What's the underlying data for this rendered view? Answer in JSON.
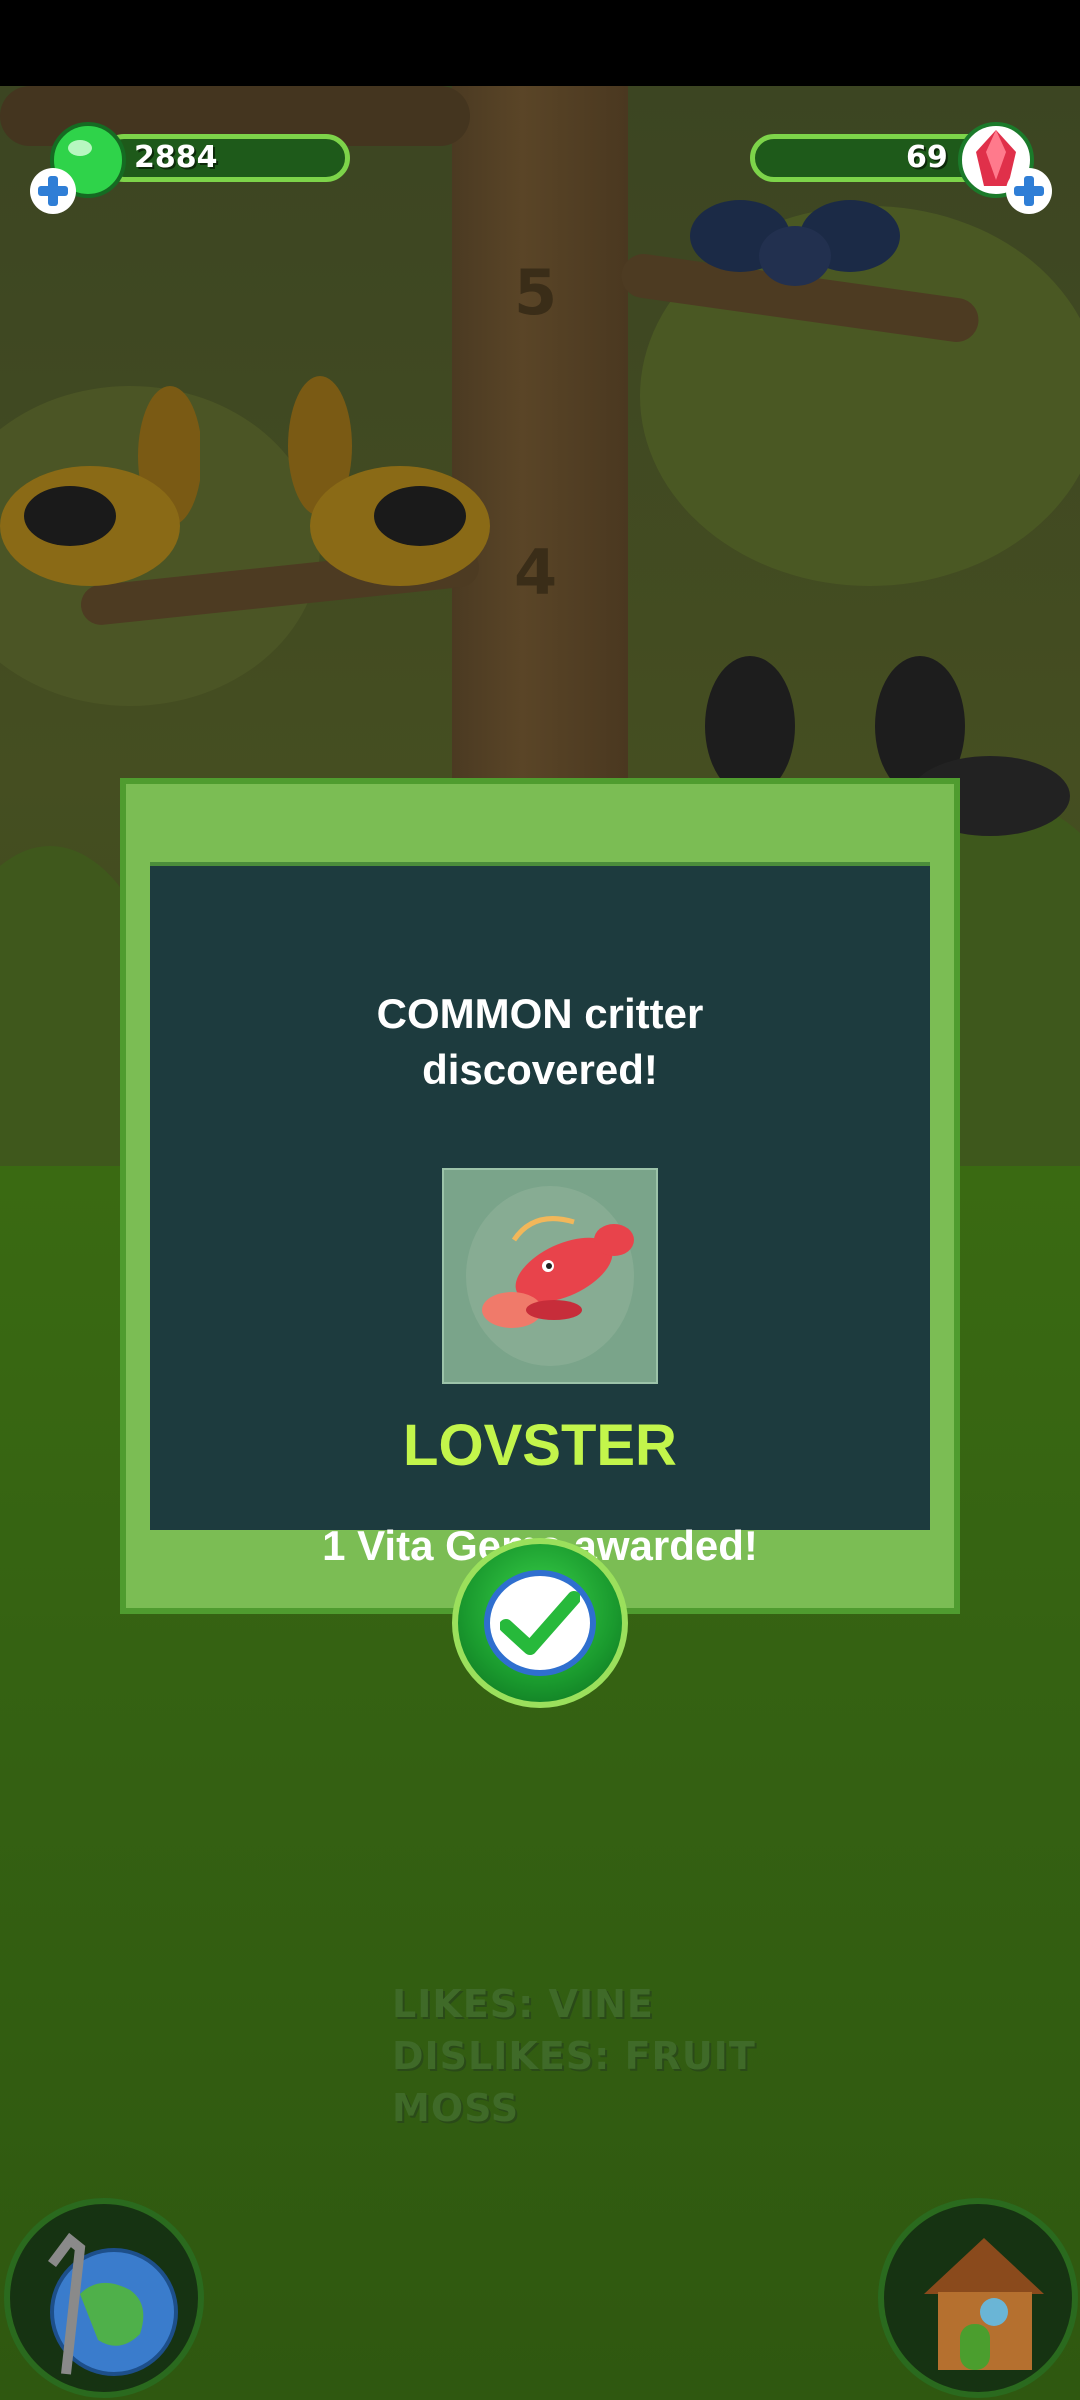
{
  "hud": {
    "left_value": "2884",
    "right_value": "69"
  },
  "trunk_numbers": [
    "5",
    "4"
  ],
  "modal": {
    "title": "COMMON critter\ndiscovered!",
    "title_line1": "COMMON critter",
    "title_line2": "discovered!",
    "critter_name": "LOVSTER",
    "reward": "1 Vita Gems awarded!"
  },
  "hint": {
    "likes": "LIKES: VINE",
    "dislikes": "DISLIKES: FRUIT",
    "dislikes_line2": "MOSS"
  },
  "icons": {
    "left_currency": "green-gem-icon",
    "right_currency": "red-crystal-icon",
    "plus": "plus-icon",
    "confirm": "checkmark-icon",
    "world": "globe-icon",
    "home": "house-icon"
  },
  "colors": {
    "modal_bg": "#7bbd54",
    "modal_inner": "#1d3b3e",
    "critter_name": "#c3f54b",
    "confirm_green": "#1a9a2e"
  }
}
